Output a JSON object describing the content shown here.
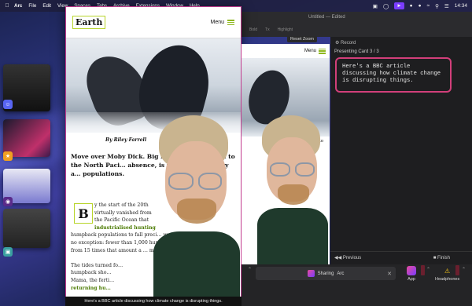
{
  "menubar": {
    "app_name": "Arc",
    "items": [
      "File",
      "Edit",
      "View",
      "Spaces",
      "Tabs",
      "Archive",
      "Extensions",
      "Window",
      "Help"
    ],
    "clock": "14:34"
  },
  "earth": {
    "logo": "Earth",
    "menu_label": "Menu",
    "byline": "By Riley Farrell",
    "lead": "Move over Moby Dick. Big Ma… have returned to the North Paci… absence, is telling a new story a… populations.",
    "dropcap": "B",
    "body_lines": [
      "y the start of the 20th",
      "virtually vanished from",
      "the Pacific Ocean that",
      "industrialised hunting",
      "humpback populations to fall preci… was",
      "no exception: fewer than 1,000 hum…",
      "from 15 times that amount a … mpback",
      "",
      "The tides turned fo…",
      "humpback sho…",
      "Mama, the ferti…",
      "returning hu…"
    ],
    "green_words": [
      "industrialised hunting",
      "precipitously",
      "1,000 hum",
      "15 times that amount a"
    ]
  },
  "preview": {
    "reset_zoom": "Reset Zoom",
    "menu_label": "Menu",
    "text_fragments": [
      "ed to",
      "e 20th",
      "from",
      "Ocean that",
      "hunting",
      "was",
      "mpback"
    ]
  },
  "window": {
    "title": "Untitled — Edited",
    "toolbar": [
      "Bold",
      "Tx",
      "Highlight"
    ]
  },
  "presenter": {
    "record_label": "Record",
    "card_count": "Presenting Card 3 / 3",
    "card_text": "Here's a BBC article discussing how climate change is disrupting things.",
    "prev_label": "Previous",
    "finish_label": "Finish"
  },
  "caption": "Here's a BBC article discussing how climate change is disrupting things.",
  "bottom": {
    "sharing_label": "Sharing",
    "sharing_app": "Arc",
    "app_label": "App",
    "headphones_label": "Headphones"
  },
  "colors": {
    "accent_pink": "#d23f7a",
    "earth_green": "#b8d42b",
    "menubar_badge": "#7a3cff"
  }
}
